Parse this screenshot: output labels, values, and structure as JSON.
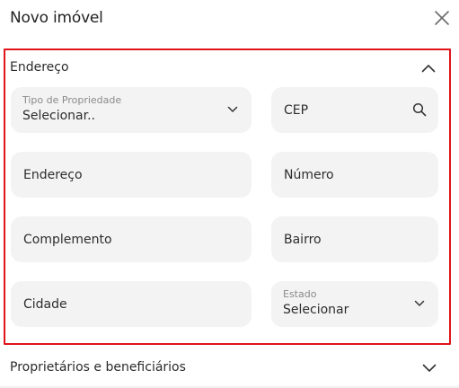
{
  "dialog": {
    "title": "Novo imóvel"
  },
  "address_section": {
    "title": "Endereço",
    "fields": {
      "property_type": {
        "label": "Tipo de Propriedade",
        "value": "Selecionar.."
      },
      "cep": {
        "placeholder": "CEP"
      },
      "address": {
        "placeholder": "Endereço"
      },
      "number": {
        "placeholder": "Número"
      },
      "complement": {
        "placeholder": "Complemento"
      },
      "neighborhood": {
        "placeholder": "Bairro"
      },
      "city": {
        "placeholder": "Cidade"
      },
      "state": {
        "label": "Estado",
        "value": "Selecionar"
      }
    }
  },
  "owners_section": {
    "title": "Proprietários e beneficiários"
  },
  "colors": {
    "highlight_border": "#e0141b",
    "field_background": "#f3f3f3"
  },
  "icons": {
    "close": "close-icon",
    "collapse": "chevron-up-icon",
    "expand": "chevron-down-icon",
    "search": "search-icon"
  }
}
